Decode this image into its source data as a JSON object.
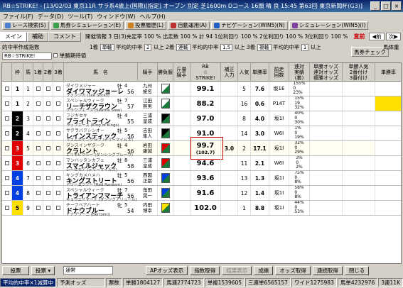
{
  "title": "RB☆STRIKE! - [13/02/03 東京11R サラ系4歳上(国際)[指定] オープン 別定 芝1600m Dコース 16頭 晴 良 15:45 第63回 東京新聞杯(G3)]",
  "menu": [
    "ファイル(F)",
    "データ(D)",
    "ツール(T)",
    "ウィンドウ(W)",
    "ヘルプ(H)"
  ],
  "toolbar": [
    "レース検索(S)",
    "馬券シミュレーション(E)",
    "投票履歴(L)",
    "自動運用(A)",
    "ナビゲーション(WIN5)(N)",
    "シミュレーション(WIN5)(I)"
  ],
  "tabs": [
    "メイン",
    "補助",
    "コメント"
  ],
  "race_info": "開催情報 3 日(3)充足率 100 %  出走数 100 %  計 94  1位利回り 100 %  2位利回り 100 %  3位利回り 100 %",
  "prev_label": "前",
  "next_label": "次",
  "live_label": "直前",
  "settings": {
    "hit_label": "的中率作成指数",
    "rank1_label": "1着",
    "rank1_sel": "単軸",
    "avg1_label": "平均的中率",
    "avg1_val": "2",
    "above1": "以上",
    "rank2_label": "2着",
    "rank2_sel": "連軸",
    "avg2_label": "平均的中率",
    "avg2_val": "1.5",
    "above2": "以上",
    "rank3_label": "3着",
    "rank3_sel": "複軸",
    "avg3_label": "平均的中率",
    "avg3_val": "1",
    "above3": "以上",
    "horse_btn": "馬券チェック",
    "sort_label": "馬体重",
    "index_sel": "RB☆STRIKE!",
    "index_mode_label": "単勝期待値"
  },
  "headers": [
    "枠",
    "馬",
    "1着",
    "2着",
    "3着",
    "馬　名",
    "",
    "騎手",
    "勝負服",
    "斤量\n騎手",
    "RB\n☆\nSTRIKE!",
    "補正\n入力",
    "人気",
    "単勝率",
    "前走\n回数",
    "連対\n実績\n(着)",
    "単勝オッズ\n連対オッズ\n複勝オッズ",
    "単勝人気\n2番付け\n3番付け",
    "単勝率\n"
  ],
  "horses": [
    {
      "frame": "1",
      "num": "1",
      "s1": "ダイワメジャー",
      "s2": "ダイワマッジョーレ",
      "s3": "ファンジカ (Lee Socks)",
      "sex": "牡",
      "age": "4",
      "jockey": "九州\n蛯名",
      "weight": "56",
      "rb": "99.1",
      "adj": "",
      "pop": "5",
      "odds": "7.6",
      "prev": "坂1E",
      "rec": "155%\n0\n23%",
      "col": "#ffffff"
    },
    {
      "frame": "1",
      "num": "2",
      "s1": "スペシャルウィーク",
      "s2": "リーチザクラウン",
      "s3": "クラウンエース (Seattle Slew)",
      "sex": "牡",
      "age": "7",
      "jockey": "江田\n照男",
      "weight": "57",
      "rb": "88.2",
      "adj": "",
      "pop": "16",
      "odds": "0.6",
      "prev": "P14T",
      "rec": "15%\n19\n32%",
      "col": "#ffffff"
    },
    {
      "frame": "2",
      "num": "3",
      "s1": "フジキセキ",
      "s2": "ブライトライン",
      "s3": "ラップエース (King of Kings)",
      "sex": "牡",
      "age": "4",
      "jockey": "三浦\n皇成",
      "weight": "55",
      "rb": "97.0",
      "adj": "",
      "pop": "8",
      "odds": "4.0",
      "prev": "坂1I",
      "rec": "40%\n0\n30%",
      "col": "#000000"
    },
    {
      "frame": "2",
      "num": "4",
      "s1": "サクラバクシンオー",
      "s2": "レインスティック",
      "s3": "リズムネヤングラヴ (デリーマイルズ)",
      "sex": "牡",
      "age": "5",
      "jockey": "吉田\n隼人",
      "weight": "56",
      "rb": "91.0",
      "adj": "",
      "pop": "14",
      "odds": "3.0",
      "prev": "W6I",
      "rec": "1%\n0\n19%",
      "col": "#000000"
    },
    {
      "frame": "3",
      "num": "5",
      "s1": "ダンスインザダーク",
      "s2": "クラレント",
      "s3": "エリモピクシー (ダンシングブレーヴ)",
      "sex": "牡",
      "age": "4",
      "jockey": "岩田\n康誠",
      "weight": "56",
      "rb": "99.7",
      "rb2": "(102.7)",
      "adj": "3.0",
      "pop": "2",
      "odds": "17.1",
      "prev": "坂1I",
      "rec": "32%\n0\n29%",
      "col": "#e00000"
    },
    {
      "frame": "3",
      "num": "6",
      "s1": "マンハッタンカフェ",
      "s2": "スマイルジャック",
      "s3": "シーセモア (デリーマイルズ)",
      "sex": "牡",
      "age": "8",
      "jockey": "三浦\n皇成",
      "weight": "58",
      "rb": "94.6",
      "adj": "",
      "pop": "11",
      "odds": "2.1",
      "prev": "W6I",
      "rec": "3%\n0\n2%",
      "col": "#e00000"
    },
    {
      "frame": "4",
      "num": "7",
      "s1": "キングカメハメハ",
      "s2": "キングストリート",
      "s3": "ドリームツアー (Red Ransom)",
      "sex": "牡",
      "age": "5",
      "jockey": "西図\n正都",
      "weight": "56",
      "rb": "93.6",
      "adj": "",
      "pop": "13",
      "odds": "1.3",
      "prev": "坂1I",
      "rec": "75%\n0\n8%",
      "col": "#0040e0"
    },
    {
      "frame": "4",
      "num": "8",
      "s1": "スペシャルウィーク",
      "s2": "トライアンフマーチ",
      "s3": "キョウエイマーチ (ダンジグアリュール)",
      "sex": "牡",
      "age": "7",
      "jockey": "角田\n晃一",
      "weight": "56",
      "rb": "91.6",
      "adj": "",
      "pop": "12",
      "odds": "1.4",
      "prev": "坂1I",
      "rec": "58%\n0\n8%",
      "col": "#0040e0"
    },
    {
      "frame": "5",
      "num": "9",
      "s1": "チーフベアハート",
      "s2": "ドナウブルー",
      "s3": "ドナブリーニ (Bertolini)",
      "sex": "牝",
      "age": "5",
      "jockey": "内田\n博幸",
      "weight": "54",
      "rb": "102.0",
      "adj": "",
      "pop": "1",
      "odds": "8.8",
      "prev": "坂1I",
      "rec": "44%\n0\n53%",
      "col": "#ffe000"
    }
  ],
  "bottom": {
    "vote": "投票",
    "vote2": "投票",
    "mode_sel": "通常",
    "b1": "APオッズ表示",
    "b2": "指数取得",
    "b3": "結果表示",
    "b4": "成績",
    "b5": "オッズ取得",
    "b6": "連続取得",
    "b7": "閉じる"
  },
  "status": {
    "hit": "平均的中率×1減算中",
    "odds": "予測オッズ",
    "f1": "票数",
    "f2": "単勝1804127",
    "f3": "馬連2774723",
    "f4": "単複1539605",
    "f5": "三連単6565157",
    "f6": "ワイド1275983",
    "f7": "馬単4232976",
    "f8": "3連11K"
  },
  "colors": {
    "title_bg": "#0a246a",
    "red": "#cc0000"
  }
}
